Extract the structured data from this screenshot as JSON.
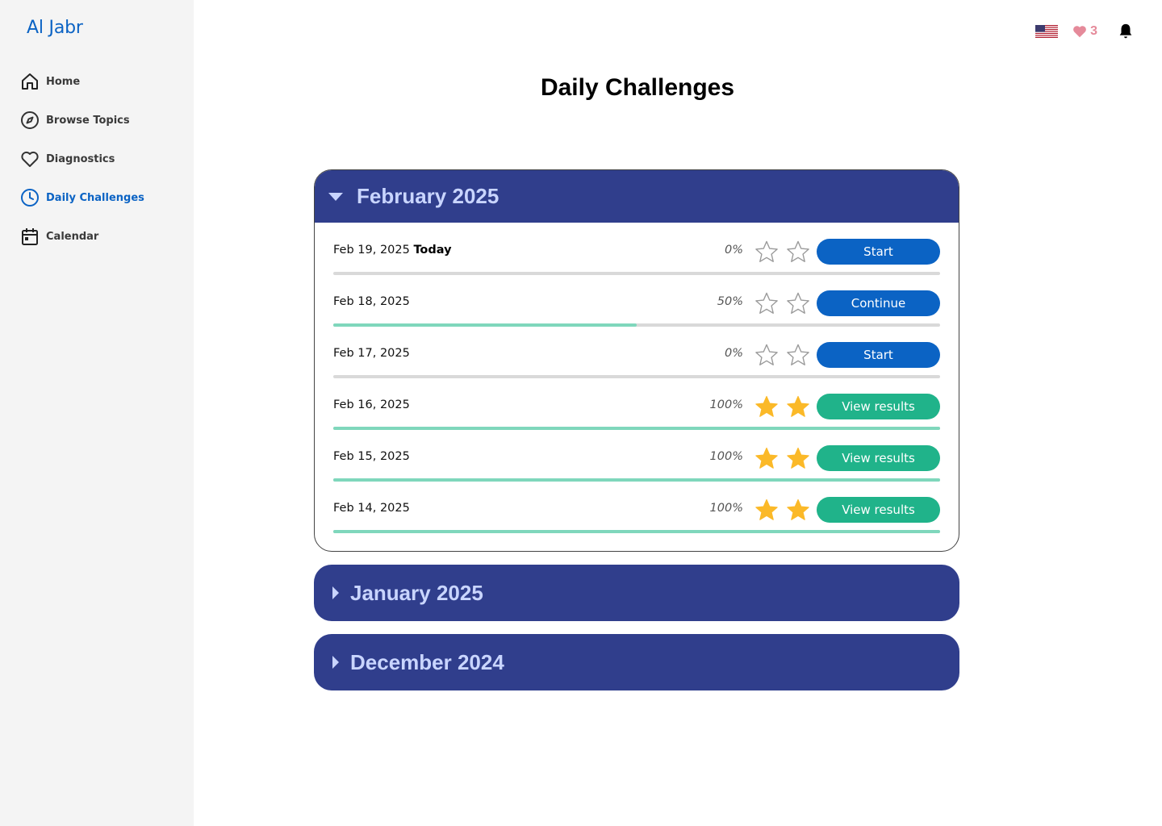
{
  "app": {
    "logo": "Al Jabr"
  },
  "sidebar": {
    "items": [
      {
        "label": "Home",
        "icon": "home-icon",
        "active": false
      },
      {
        "label": "Browse Topics",
        "icon": "compass-icon",
        "active": false
      },
      {
        "label": "Diagnostics",
        "icon": "heart-outline-icon",
        "active": false
      },
      {
        "label": "Daily Challenges",
        "icon": "clock-icon",
        "active": true
      },
      {
        "label": "Calendar",
        "icon": "calendar-icon",
        "active": false
      }
    ]
  },
  "topbar": {
    "language_icon": "us-flag-icon",
    "hearts_count": "3",
    "notifications_icon": "bell-icon"
  },
  "page": {
    "title": "Daily Challenges"
  },
  "months": [
    {
      "label": "February 2025",
      "expanded": true,
      "challenges": [
        {
          "date": "Feb 19, 2025",
          "tag": "Today",
          "percent": "0%",
          "progress": 0,
          "stars": 0,
          "button": "Start",
          "button_style": "blue"
        },
        {
          "date": "Feb 18, 2025",
          "tag": "",
          "percent": "50%",
          "progress": 0.5,
          "stars": 0,
          "button": "Continue",
          "button_style": "blue"
        },
        {
          "date": "Feb 17, 2025",
          "tag": "",
          "percent": "0%",
          "progress": 0,
          "stars": 0,
          "button": "Start",
          "button_style": "blue"
        },
        {
          "date": "Feb 16, 2025",
          "tag": "",
          "percent": "100%",
          "progress": 1,
          "stars": 2,
          "button": "View results",
          "button_style": "green"
        },
        {
          "date": "Feb 15, 2025",
          "tag": "",
          "percent": "100%",
          "progress": 1,
          "stars": 2,
          "button": "View results",
          "button_style": "green"
        },
        {
          "date": "Feb 14, 2025",
          "tag": "",
          "percent": "100%",
          "progress": 1,
          "stars": 2,
          "button": "View results",
          "button_style": "green"
        }
      ]
    },
    {
      "label": "January 2025",
      "expanded": false
    },
    {
      "label": "December 2024",
      "expanded": false
    }
  ],
  "colors": {
    "brand_blue": "#0b63c4",
    "month_header": "#303e8c",
    "month_header_text": "#c9d5ff",
    "success_green": "#20b38a",
    "progress_fill": "#7fd7bc",
    "star_gold": "#fbb928",
    "heart_pink": "#e58a9a"
  }
}
